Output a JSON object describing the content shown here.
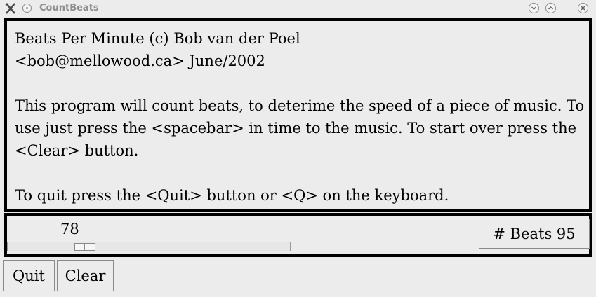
{
  "window": {
    "title": "CountBeats",
    "controls": [
      "minimize-icon",
      "maximize-icon",
      "close-icon"
    ]
  },
  "message": {
    "line1": "Beats Per Minute (c) Bob van der Poel",
    "line2": "<bob@mellowood.ca> June/2002",
    "paragraph2": "This program will count beats, to deterime the speed of a piece of music. To use just press the <spacebar> in time to the music. To start over press the <Clear> button.",
    "paragraph3": "To quit press the <Quit> button or <Q> on the keyboard."
  },
  "scale": {
    "value": "78",
    "level": 0.22
  },
  "beats_button": {
    "label": "# Beats 95"
  },
  "buttons": {
    "quit_label": "Quit",
    "clear_label": "Clear"
  }
}
